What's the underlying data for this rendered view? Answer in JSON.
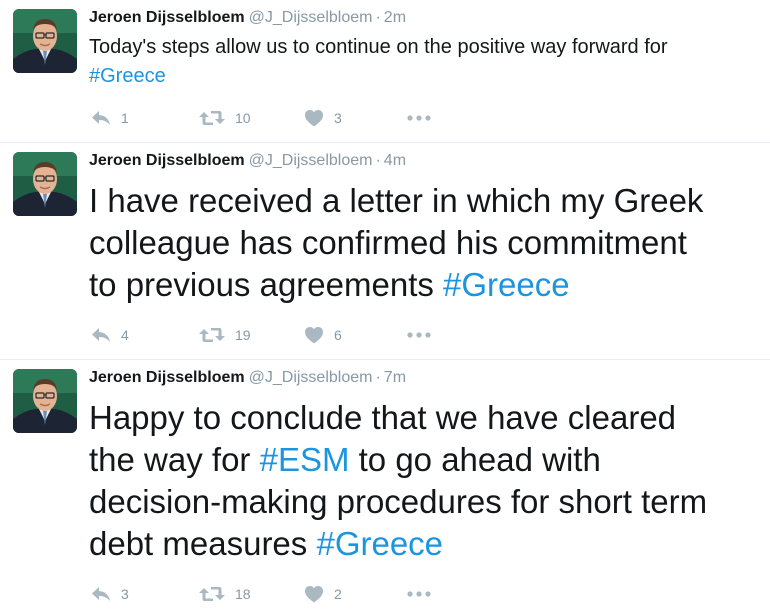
{
  "tweets": [
    {
      "author": {
        "name": "Jeroen Dijsselbloem",
        "handle": "@J_Dijsselbloem"
      },
      "separator": "·",
      "time": "2m",
      "text_before": "Today's steps allow us to continue on the positive way forward for",
      "hashtag": "#Greece",
      "replies": "1",
      "retweets": "10",
      "likes": "3"
    },
    {
      "author": {
        "name": "Jeroen Dijsselbloem",
        "handle": "@J_Dijsselbloem"
      },
      "separator": "·",
      "time": "4m",
      "lines": [
        "I have received a letter in which my Greek",
        "colleague has confirmed his commitment",
        "to previous agreements"
      ],
      "hashtag": "#Greece",
      "replies": "4",
      "retweets": "19",
      "likes": "6"
    },
    {
      "author": {
        "name": "Jeroen Dijsselbloem",
        "handle": "@J_Dijsselbloem"
      },
      "separator": "·",
      "time": "7m",
      "lines": [
        "Happy to conclude that we have cleared",
        "the way for",
        "to go ahead with",
        "decision-making procedures for short term",
        "debt measures"
      ],
      "hashtags": [
        "#ESM",
        "#Greece"
      ],
      "replies": "3",
      "retweets": "18",
      "likes": "2"
    }
  ],
  "colors": {
    "text": "#14171a",
    "muted": "#8899a6",
    "icon": "#aab8c2",
    "link": "#1b95e0",
    "divider": "#e6ecf0"
  },
  "icons": {
    "avatar": "profile-photo",
    "reply": "reply-icon",
    "retweet": "retweet-icon",
    "like": "heart-icon",
    "more": "more-dots-icon"
  }
}
